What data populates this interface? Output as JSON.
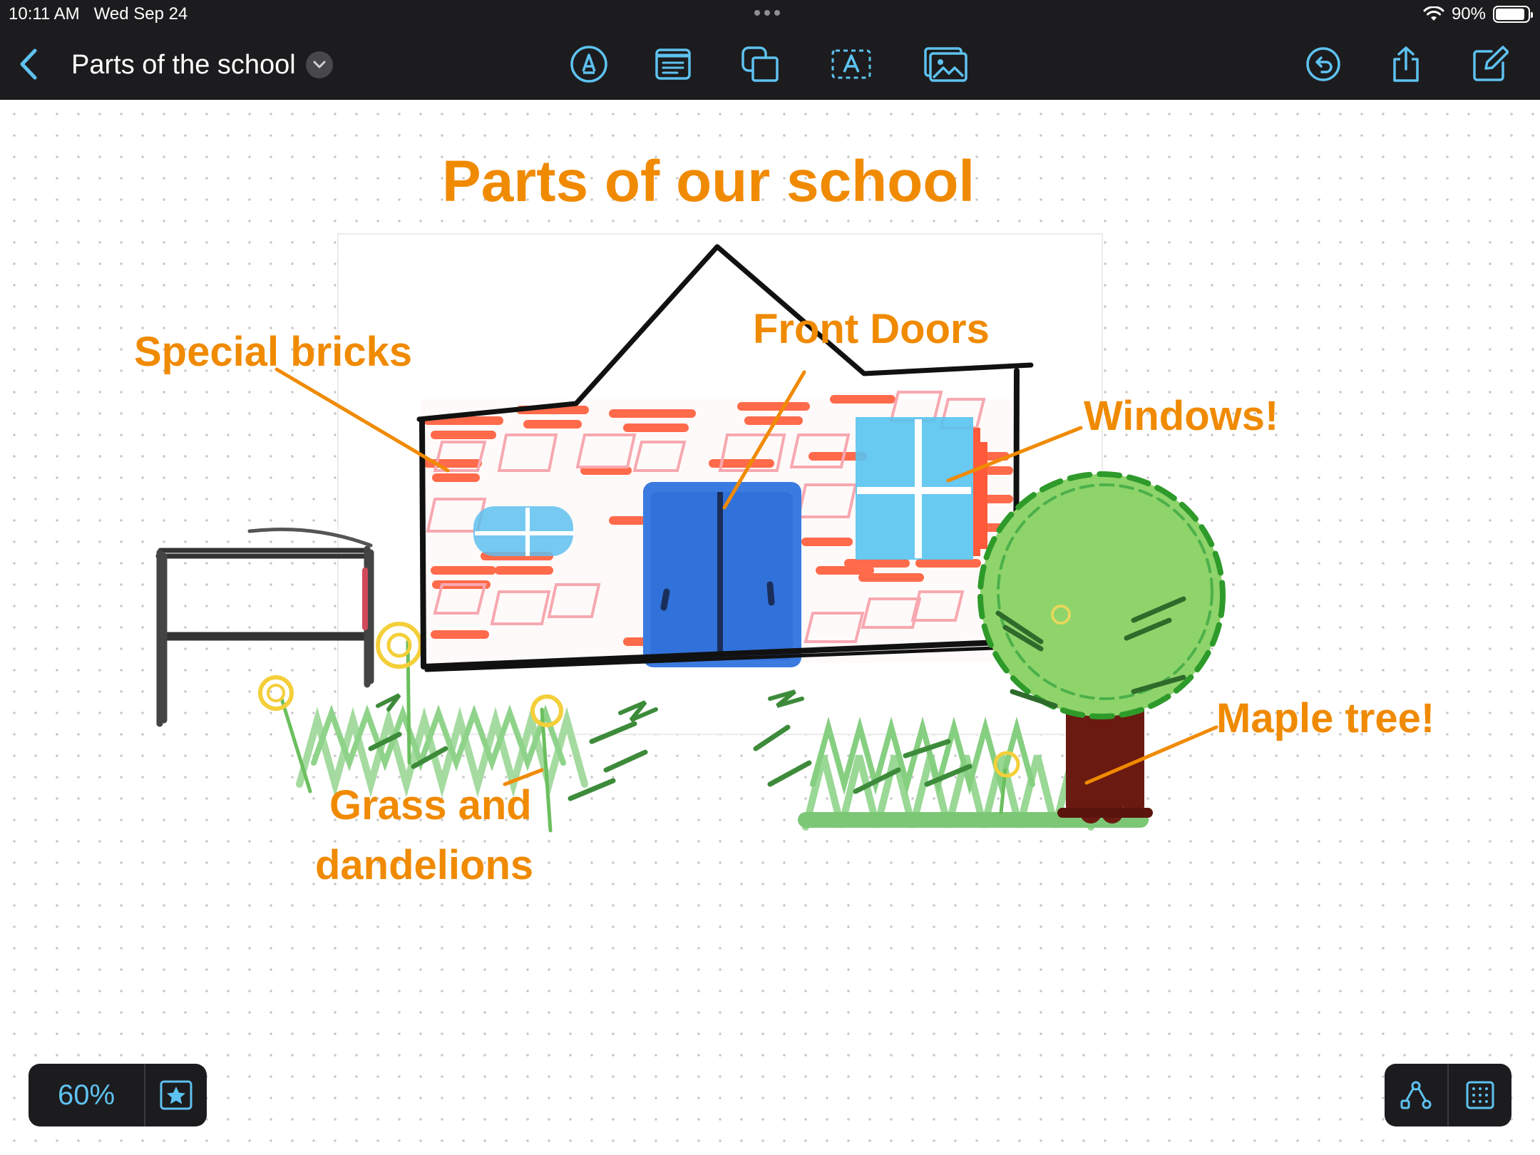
{
  "status_bar": {
    "time": "10:11 AM",
    "date": "Wed Sep 24",
    "battery_percent": "90%",
    "battery_level": 0.9
  },
  "toolbar": {
    "document_title": "Parts of the school",
    "accent_color": "#5ec2f0",
    "tools": [
      {
        "name": "pen-tool",
        "icon": "pen-nib-icon"
      },
      {
        "name": "text-box",
        "icon": "text-box-icon"
      },
      {
        "name": "shapes",
        "icon": "shapes-icon"
      },
      {
        "name": "text-insert",
        "icon": "text-a-icon"
      },
      {
        "name": "media",
        "icon": "photo-icon"
      }
    ],
    "right_actions": [
      {
        "name": "undo",
        "icon": "undo-icon"
      },
      {
        "name": "share",
        "icon": "share-icon"
      },
      {
        "name": "new-board",
        "icon": "compose-icon"
      }
    ]
  },
  "board": {
    "title": "Parts of our school",
    "label_color": "#f08a00",
    "labels": {
      "special_bricks": "Special bricks",
      "front_doors": "Front Doors",
      "windows": "Windows!",
      "maple_tree": "Maple tree!",
      "grass_line1": "Grass and",
      "grass_line2": "dandelions"
    }
  },
  "bottom_controls": {
    "zoom": "60%",
    "favorites_icon": "star-icon",
    "diagram_icon": "connector-icon",
    "grid_icon": "grid-icon"
  }
}
